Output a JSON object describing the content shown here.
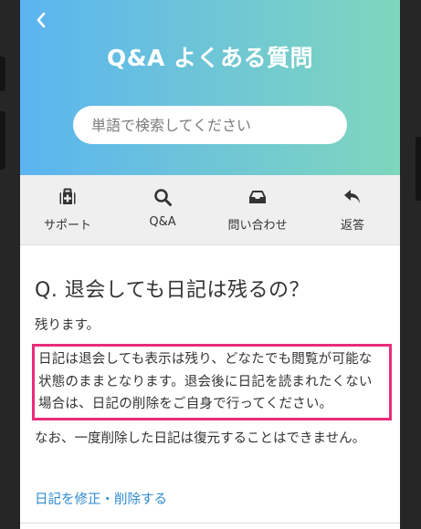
{
  "header": {
    "title": "Q&A よくある質問",
    "search_placeholder": "単語で検索してください"
  },
  "nav": [
    {
      "label": "サポート",
      "icon": "first-aid-kit-icon"
    },
    {
      "label": "Q&A",
      "icon": "search-icon"
    },
    {
      "label": "問い合わせ",
      "icon": "inbox-tray-icon"
    },
    {
      "label": "返答",
      "icon": "reply-arrow-icon"
    }
  ],
  "content": {
    "question": "Q. 退会しても日記は残るの？",
    "answer_short": "残ります。",
    "answer_highlight": "日記は退会しても表示は残り、どなたでも閲覧が可能な状態のままとなります。退会後に日記を読まれたくない場合は、日記の削除をご自身で行ってください。",
    "answer_note": "なお、一度削除した日記は復元することはできません。",
    "link": "日記を修正・削除する"
  },
  "colors": {
    "header_gradient_start": "#5bb4f0",
    "header_gradient_end": "#7fd6bd",
    "highlight_border": "#e92c7a",
    "link": "#2f8bd1"
  }
}
